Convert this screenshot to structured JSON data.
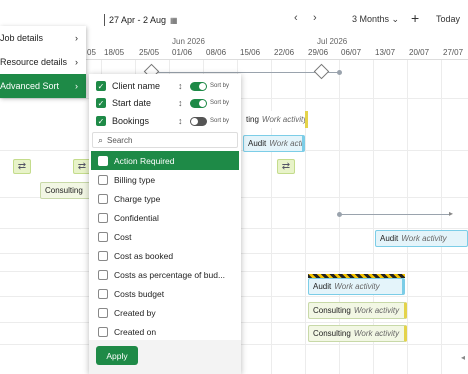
{
  "toolbar": {
    "date_range": "27 Apr - 2 Aug",
    "view_select": "3 Months",
    "today_label": "Today"
  },
  "timeline": {
    "months": [
      "Jun 2026",
      "Jul 2026"
    ],
    "days": [
      "05",
      "18/05",
      "25/05",
      "01/06",
      "08/06",
      "15/06",
      "22/06",
      "29/06",
      "06/07",
      "13/07",
      "20/07",
      "27/07"
    ]
  },
  "tasks": [
    {
      "name": "Consulting",
      "sub": ""
    },
    {
      "name": "Audit",
      "sub": "Work activity"
    },
    {
      "name": "Audit",
      "sub": "Work activity"
    },
    {
      "name": "Consulting",
      "sub": "Work activity"
    },
    {
      "name": "Consulting",
      "sub": "Work activity"
    },
    {
      "name": "",
      "sub": "Work activity"
    },
    {
      "name": "Audit",
      "sub": "Work acti..."
    }
  ],
  "left_menu": {
    "items": [
      {
        "label": "Job details"
      },
      {
        "label": "Resource details"
      },
      {
        "label": "Advanced Sort"
      }
    ]
  },
  "sort_panel": {
    "selected": [
      {
        "label": "Client name",
        "toggle_label": "Sort by",
        "on": true
      },
      {
        "label": "Start date",
        "toggle_label": "Sort by",
        "on": true
      },
      {
        "label": "Bookings",
        "toggle_label": "Sort by",
        "on": false
      }
    ],
    "search_placeholder": "Search",
    "options": [
      {
        "label": "Action Required"
      },
      {
        "label": "Billing type"
      },
      {
        "label": "Charge type"
      },
      {
        "label": "Confidential"
      },
      {
        "label": "Cost"
      },
      {
        "label": "Cost as booked"
      },
      {
        "label": "Costs as percentage of bud..."
      },
      {
        "label": "Costs budget"
      },
      {
        "label": "Created by"
      },
      {
        "label": "Created on"
      }
    ],
    "apply_label": "Apply"
  },
  "colors": {
    "brand": "#1e8a47",
    "task_green": "#f2f7e4",
    "task_blue": "#e4f4fa"
  }
}
